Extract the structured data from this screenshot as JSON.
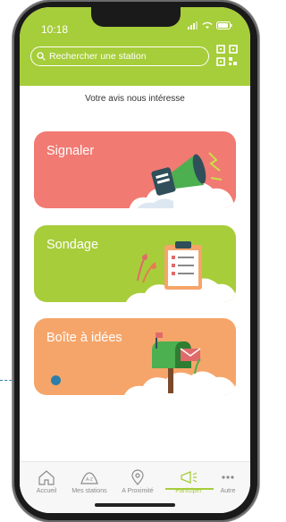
{
  "status_bar": {
    "time": "10:18"
  },
  "header": {
    "search_placeholder": "Rechercher une station"
  },
  "subtitle": "Votre avis nous intéresse",
  "cards": [
    {
      "label": "Signaler",
      "color": "#f17a72",
      "icon": "megaphone-icon"
    },
    {
      "label": "Sondage",
      "color": "#a7cd3b",
      "icon": "clipboard-icon"
    },
    {
      "label": "Boîte à idées",
      "color": "#f6a56a",
      "icon": "mailbox-icon"
    }
  ],
  "tabs": [
    {
      "label": "Accueil",
      "icon": "home-icon"
    },
    {
      "label": "Mes stations",
      "icon": "stations-icon"
    },
    {
      "label": "A Proximité",
      "icon": "location-pin-icon"
    },
    {
      "label": "Participer",
      "icon": "megaphone-icon",
      "active": true
    },
    {
      "label": "Autre",
      "icon": "more-icon"
    }
  ],
  "colors": {
    "brand": "#a6cd3a"
  }
}
